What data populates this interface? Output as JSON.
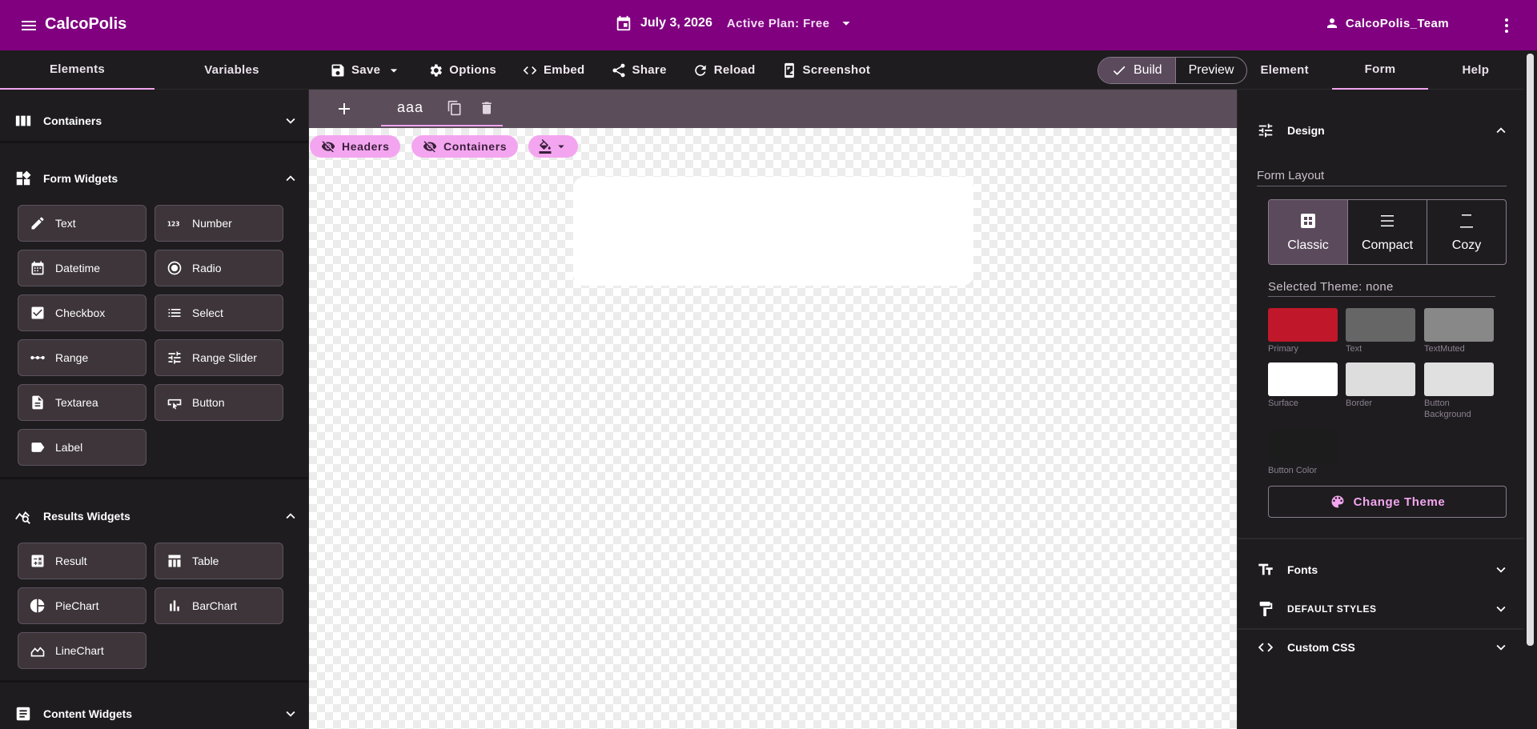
{
  "app": {
    "title": "CalcoPolis",
    "date": "July 3, 2026",
    "plan": "Active Plan: Free",
    "user": "CalcoPolis_Team"
  },
  "left_tabs": [
    "Elements",
    "Variables"
  ],
  "toolbar": {
    "save": "Save",
    "options": "Options",
    "embed": "Embed",
    "share": "Share",
    "reload": "Reload",
    "screenshot": "Screenshot"
  },
  "mode": {
    "build": "Build",
    "preview": "Preview",
    "active": "Build"
  },
  "right_tabs": [
    "Element",
    "Form",
    "Help"
  ],
  "left_panel": {
    "containers": "Containers",
    "form_widgets": {
      "title": "Form Widgets",
      "items": [
        "Text",
        "Number",
        "Datetime",
        "Radio",
        "Checkbox",
        "Select",
        "Range",
        "Range Slider",
        "Textarea",
        "Button",
        "Label"
      ]
    },
    "results_widgets": {
      "title": "Results Widgets",
      "items": [
        "Result",
        "Table",
        "PieChart",
        "BarChart",
        "LineChart"
      ]
    },
    "content_widgets": "Content Widgets"
  },
  "canvas": {
    "page_tab": "aaa",
    "chips": {
      "headers": "Headers",
      "containers": "Containers"
    }
  },
  "right_panel": {
    "design": "Design",
    "form_layout_label": "Form Layout",
    "layouts": [
      "Classic",
      "Compact",
      "Cozy"
    ],
    "selected_layout": "Classic",
    "selected_theme": "Selected Theme: none",
    "swatches": [
      {
        "label": "Primary",
        "color": "#c0182a"
      },
      {
        "label": "Text",
        "color": "#666666"
      },
      {
        "label": "TextMuted",
        "color": "#888888"
      },
      {
        "label": "Surface",
        "color": "#ffffff"
      },
      {
        "label": "Border",
        "color": "#dddddd"
      },
      {
        "label": "Button Background",
        "color": "#e0e0e0"
      },
      {
        "label": "Button Color",
        "color": "#1c1c1c"
      }
    ],
    "change_theme": "Change Theme",
    "fonts": "Fonts",
    "default_styles": "DEFAULT STYLES",
    "custom_css": "Custom CSS"
  },
  "colors": {
    "topbar": "#800080",
    "accent": "#f3a6ef",
    "panel": "#1e1c1f",
    "widget_button": "#3d3539"
  }
}
